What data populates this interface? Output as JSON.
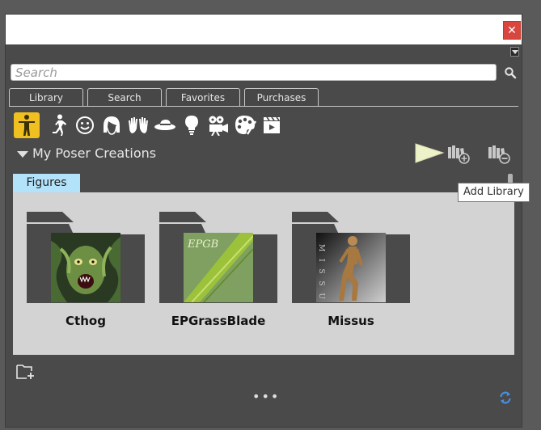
{
  "window": {
    "close_label": "✕",
    "menu_icon": "menu-triangle-icon"
  },
  "search": {
    "placeholder": "Search",
    "value": "",
    "icon": "search-icon"
  },
  "tabs": [
    {
      "label": "Library"
    },
    {
      "label": "Search"
    },
    {
      "label": "Favorites"
    },
    {
      "label": "Purchases"
    }
  ],
  "categories": [
    {
      "name": "figures-icon",
      "active": true
    },
    {
      "name": "poses-icon"
    },
    {
      "name": "expressions-icon"
    },
    {
      "name": "hair-icon"
    },
    {
      "name": "hands-icon"
    },
    {
      "name": "props-icon"
    },
    {
      "name": "lights-icon"
    },
    {
      "name": "cameras-icon"
    },
    {
      "name": "materials-icon"
    },
    {
      "name": "scenes-icon"
    }
  ],
  "section": {
    "title": "My Poser Creations"
  },
  "tooltip": {
    "text": "Add Library"
  },
  "category_chip": {
    "label": "Figures"
  },
  "items": [
    {
      "label": "Cthog"
    },
    {
      "label": "EPGrassBlade",
      "thumb_text": "EPGB"
    },
    {
      "label": "Missus",
      "thumb_text": "M I S S U S"
    }
  ],
  "footer": {
    "more": "•••"
  },
  "colors": {
    "accent": "#f0c020",
    "chip": "#b3e3fb",
    "close": "#d9463f",
    "panel": "#4a4a4a"
  }
}
